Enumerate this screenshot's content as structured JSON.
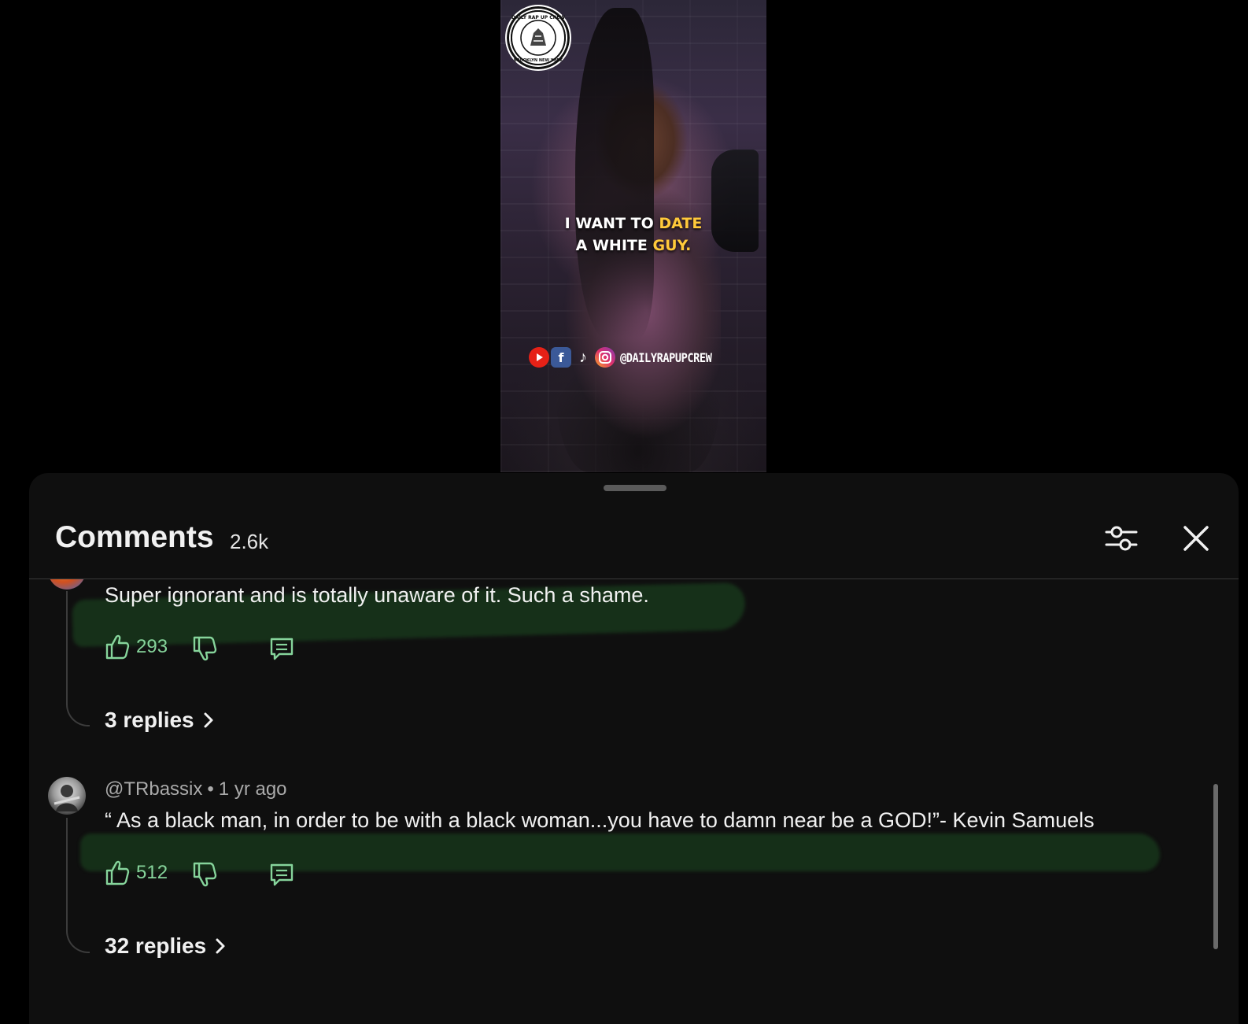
{
  "video": {
    "logo_text": "DAILY RAP UP CREW · BROOKLYN NEW YORK",
    "caption_line1_white": "I WANT TO ",
    "caption_line1_yellow": "DATE",
    "caption_line2_white": "A WHITE ",
    "caption_line2_yellow": "GUY.",
    "social_handle": "@DAILYRAPUPCREW",
    "social_icons": [
      "youtube-icon",
      "facebook-icon",
      "tiktok-icon",
      "instagram-icon"
    ]
  },
  "comments_panel": {
    "title": "Comments",
    "count": "2.6k",
    "filter_icon": "sliders-icon",
    "close_icon": "close-icon"
  },
  "comments": [
    {
      "text": "Super ignorant and is totally unaware of it. Such a shame.",
      "likes": "293",
      "replies_label": "3 replies"
    },
    {
      "author": "@TRbassix",
      "age": "1 yr ago",
      "text": "“ As a black man, in order to be with a black woman...you have to damn near be a GOD!”- Kevin Samuels",
      "likes": "512",
      "replies_label": "32 replies"
    }
  ],
  "colors": {
    "background": "#0f0f0f",
    "like_count": "#86d49b",
    "caption_highlight": "#ffc93a",
    "highlight_stroke": "#1f5a27"
  }
}
